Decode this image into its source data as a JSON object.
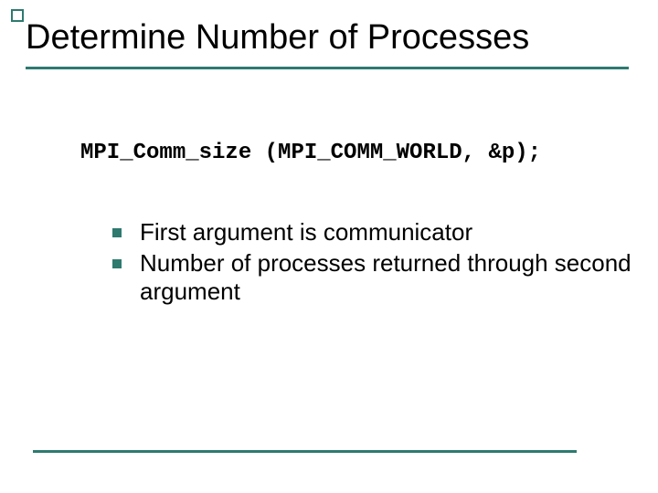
{
  "title": "Determine Number of Processes",
  "code": "MPI_Comm_size (MPI_COMM_WORLD, &p);",
  "bullets": [
    "First argument is communicator",
    "Number of processes returned through second argument"
  ]
}
